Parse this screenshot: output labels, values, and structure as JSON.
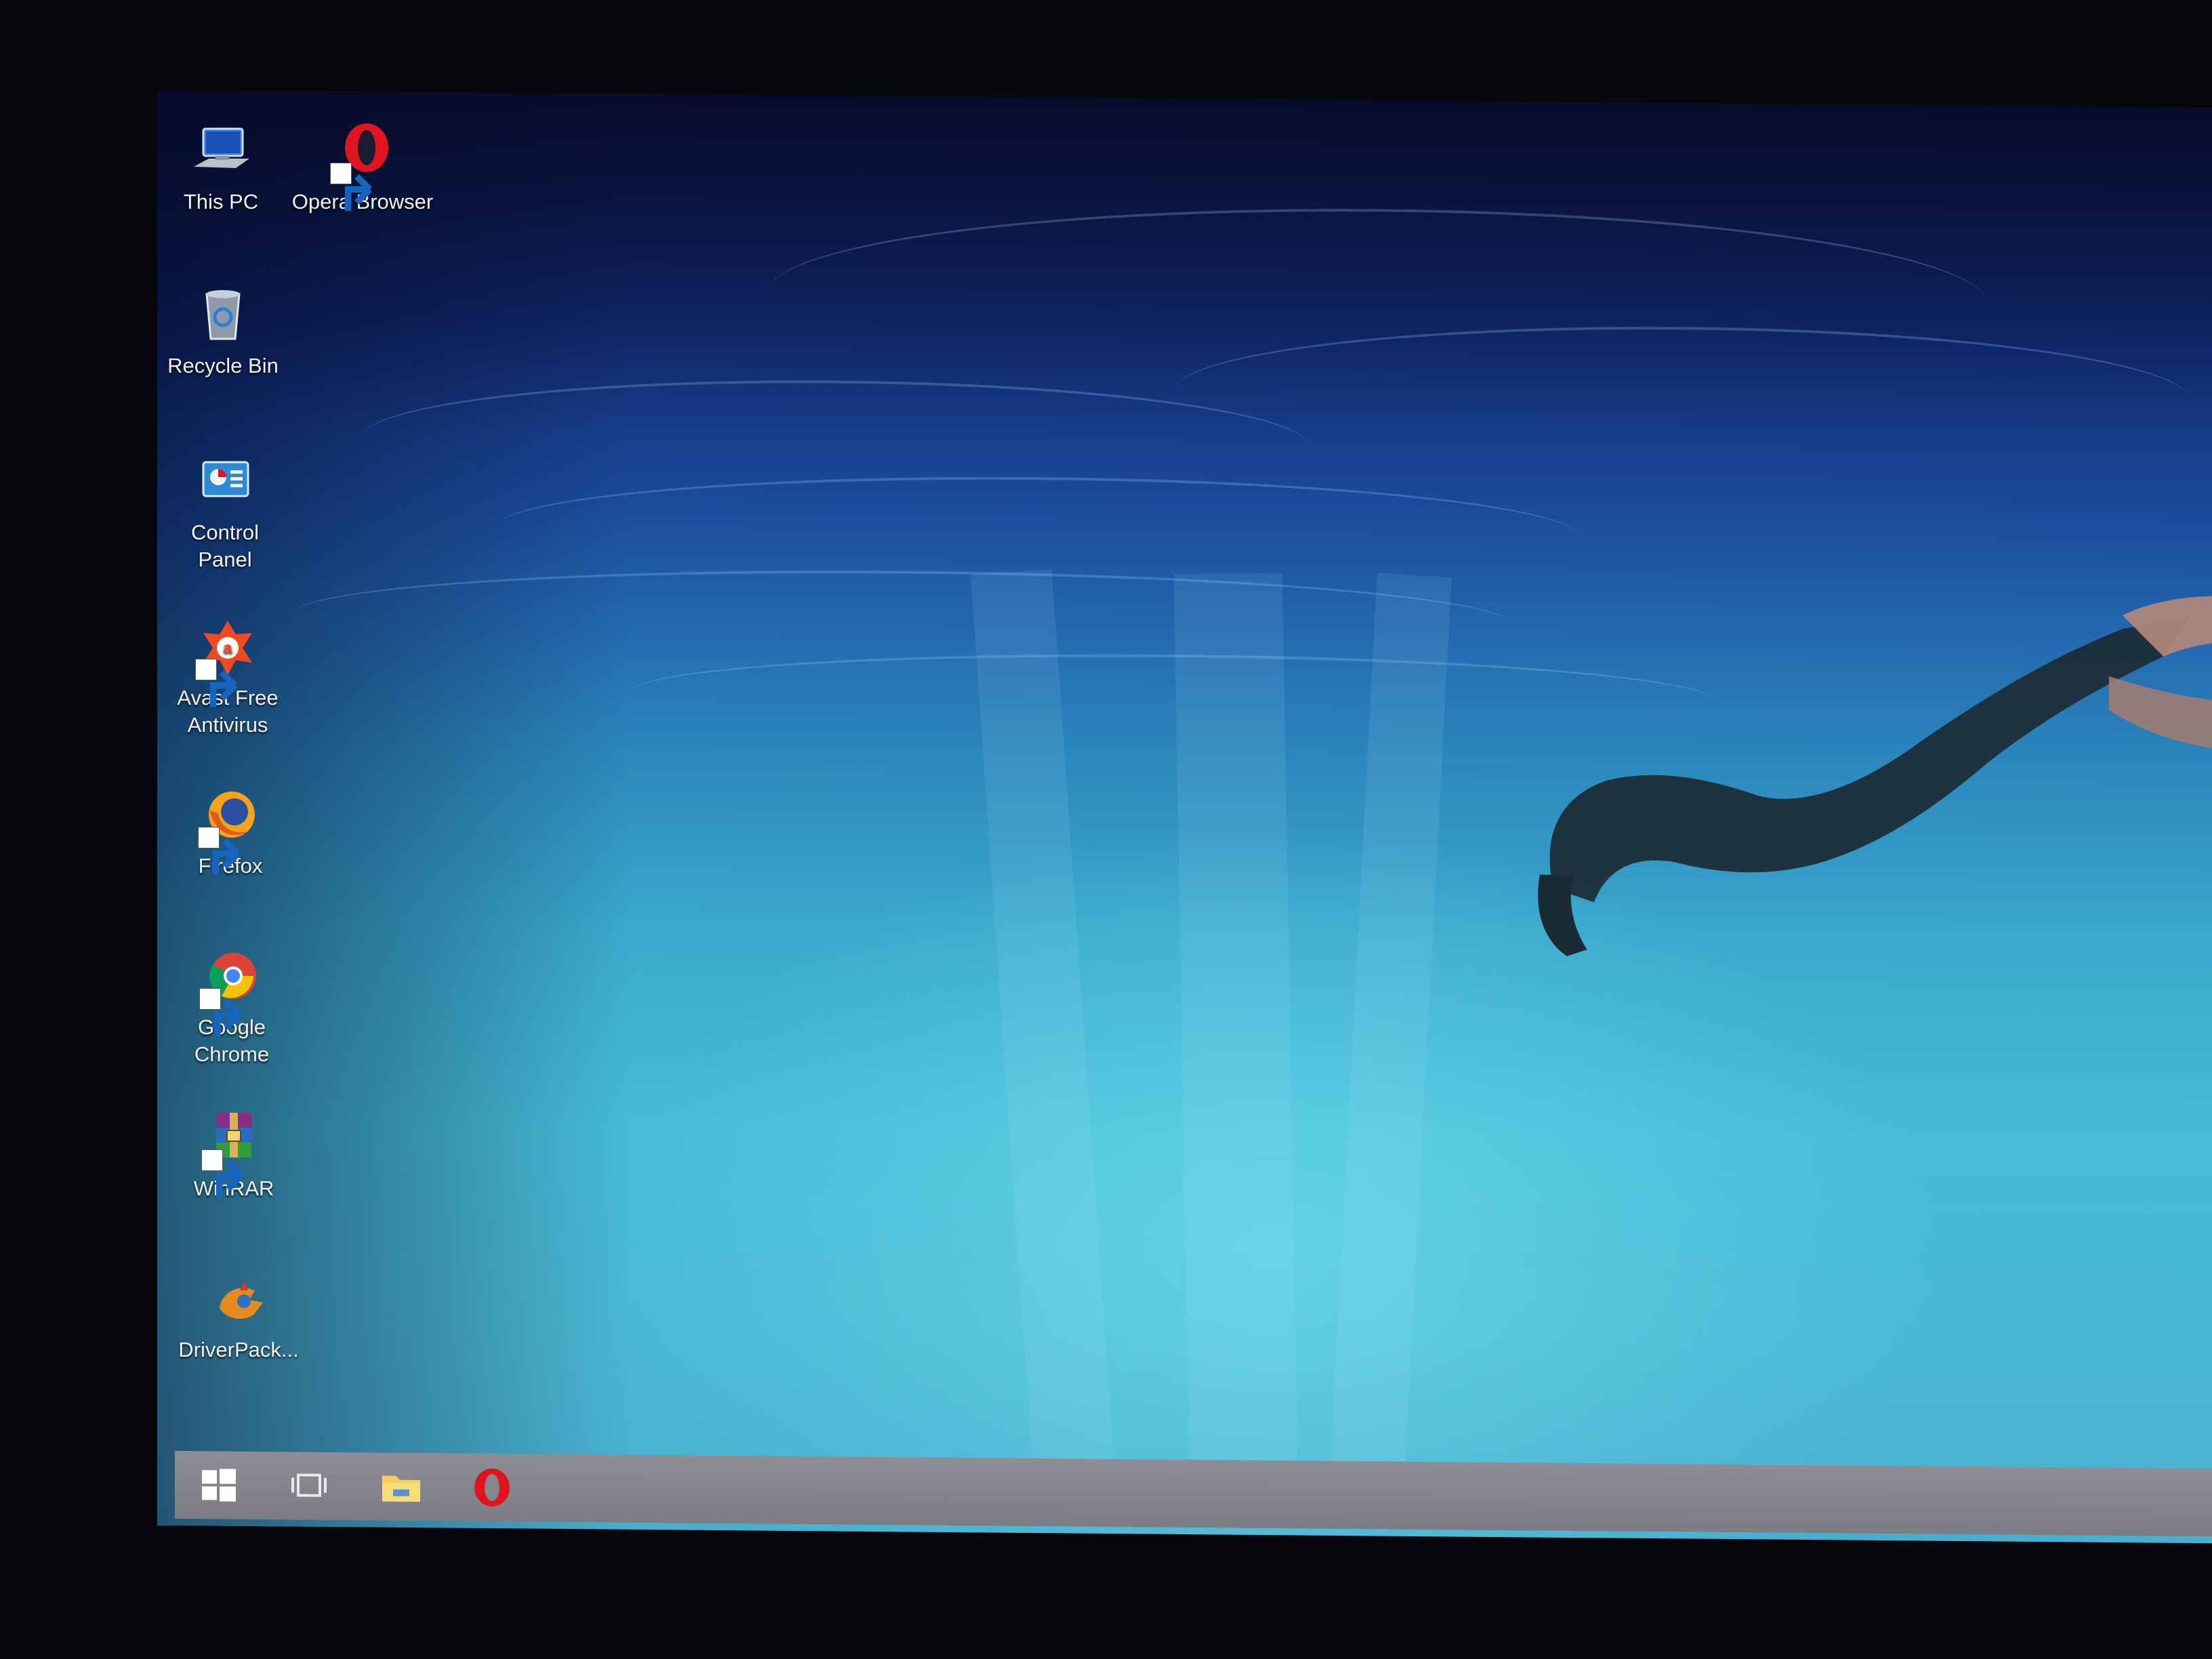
{
  "desktop": {
    "icons": [
      {
        "label": "This PC",
        "icon": "computer-icon"
      },
      {
        "label": "Opera Browser",
        "icon": "opera-icon"
      },
      {
        "label": "Recycle Bin",
        "icon": "recycle-bin-icon"
      },
      {
        "label": "Control Panel",
        "icon": "control-panel-icon"
      },
      {
        "label": "Avast Free Antivirus",
        "icon": "avast-icon"
      },
      {
        "label": "Firefox",
        "icon": "firefox-icon"
      },
      {
        "label": "Google Chrome",
        "icon": "chrome-icon"
      },
      {
        "label": "WinRAR",
        "icon": "winrar-icon"
      },
      {
        "label": "DriverPack...",
        "icon": "driverpack-icon"
      }
    ],
    "wallpaper": "underwater-swimmer"
  },
  "taskbar": {
    "buttons": [
      {
        "name": "start",
        "icon": "windows-logo-icon"
      },
      {
        "name": "task-view",
        "icon": "task-view-icon"
      },
      {
        "name": "file-explorer",
        "icon": "folder-icon"
      },
      {
        "name": "opera",
        "icon": "opera-icon"
      }
    ],
    "color": "#85868d"
  },
  "colors": {
    "opera_red": "#e0141e",
    "water_deep": "#122a72",
    "water_light": "#46bcd7"
  }
}
